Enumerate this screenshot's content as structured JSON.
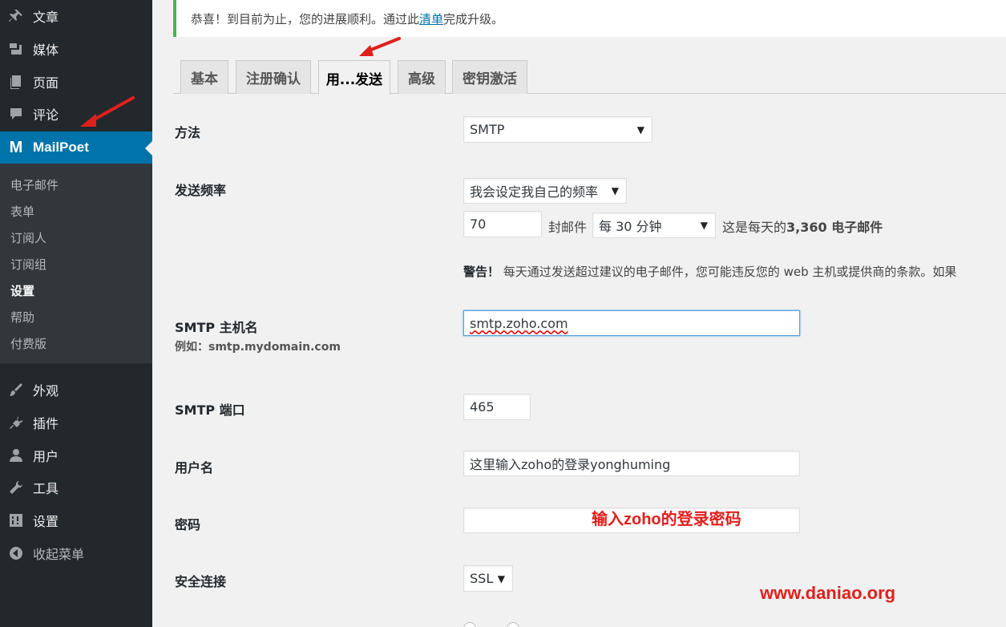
{
  "sidebar": {
    "top_items": [
      {
        "label": "文章",
        "icon": "pin-icon"
      },
      {
        "label": "媒体",
        "icon": "media-icon"
      },
      {
        "label": "页面",
        "icon": "pages-icon"
      },
      {
        "label": "评论",
        "icon": "comment-icon"
      }
    ],
    "active_item": {
      "label": "MailPoet",
      "icon_glyph": "M"
    },
    "submenu": [
      "电子邮件",
      "表单",
      "订阅人",
      "订阅组",
      "设置",
      "帮助",
      "付费版"
    ],
    "current_submenu": "设置",
    "bottom_items": [
      {
        "label": "外观",
        "icon": "brush-icon"
      },
      {
        "label": "插件",
        "icon": "plugin-icon"
      },
      {
        "label": "用户",
        "icon": "user-icon"
      },
      {
        "label": "工具",
        "icon": "wrench-icon"
      },
      {
        "label": "设置",
        "icon": "settings-icon"
      },
      {
        "label": "收起菜单",
        "icon": "collapse-icon"
      }
    ]
  },
  "notice": {
    "before": "恭喜！到目前为止，您的进展顺利。通过此",
    "link": "清单",
    "after": "完成升级。"
  },
  "tabs": [
    "基本",
    "注册确认",
    "用...发送",
    "高级",
    "密钥激活"
  ],
  "active_tab": "用...发送",
  "form": {
    "method_label": "方法",
    "method_value": "SMTP",
    "frequency_label": "发送频率",
    "frequency_value": "我会设定我自己的频率",
    "count_value": "70",
    "emails_per_text": "封邮件",
    "interval_value": "每 30 分钟",
    "daily_prefix": "这是每天的",
    "daily_count": "3,360 电子邮件",
    "warning_bold": "警告！",
    "warning_text": "每天通过发送超过建议的电子邮件，您可能违反您的 web 主机或提供商的条款。如果",
    "host_label": "SMTP 主机名",
    "host_example": "例如：smtp.mydomain.com",
    "host_value": "smtp.zoho.com",
    "port_label": "SMTP 端口",
    "port_value": "465",
    "username_label": "用户名",
    "username_value": "这里输入zoho的登录yonghuming",
    "password_label": "密码",
    "password_annotation": "输入zoho的登录密码",
    "secure_label": "安全连接",
    "secure_value": "SSL"
  },
  "watermark": "www.daniao.org",
  "colors": {
    "accent": "#0073aa",
    "sidebar": "#23282d",
    "annotation": "#e0201c",
    "notice_border": "#46b450"
  }
}
